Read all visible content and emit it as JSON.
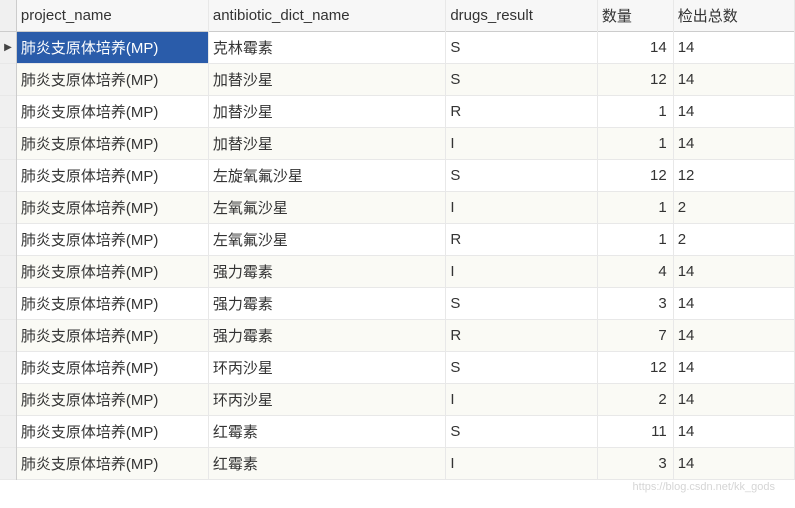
{
  "columns": {
    "col1": "project_name",
    "col2": "antibiotic_dict_name",
    "col3": "drugs_result",
    "col4": "数量",
    "col5": "检出总数"
  },
  "rows": [
    {
      "project_name": "肺炎支原体培养(MP)",
      "antibiotic": "克林霉素",
      "result": "S",
      "qty": "14",
      "total": "14"
    },
    {
      "project_name": "肺炎支原体培养(MP)",
      "antibiotic": "加替沙星",
      "result": "S",
      "qty": "12",
      "total": "14"
    },
    {
      "project_name": "肺炎支原体培养(MP)",
      "antibiotic": "加替沙星",
      "result": "R",
      "qty": "1",
      "total": "14"
    },
    {
      "project_name": "肺炎支原体培养(MP)",
      "antibiotic": "加替沙星",
      "result": "I",
      "qty": "1",
      "total": "14"
    },
    {
      "project_name": "肺炎支原体培养(MP)",
      "antibiotic": "左旋氧氟沙星",
      "result": "S",
      "qty": "12",
      "total": "12"
    },
    {
      "project_name": "肺炎支原体培养(MP)",
      "antibiotic": "左氧氟沙星",
      "result": "I",
      "qty": "1",
      "total": "2"
    },
    {
      "project_name": "肺炎支原体培养(MP)",
      "antibiotic": "左氧氟沙星",
      "result": "R",
      "qty": "1",
      "total": "2"
    },
    {
      "project_name": "肺炎支原体培养(MP)",
      "antibiotic": "强力霉素",
      "result": "I",
      "qty": "4",
      "total": "14"
    },
    {
      "project_name": "肺炎支原体培养(MP)",
      "antibiotic": "强力霉素",
      "result": "S",
      "qty": "3",
      "total": "14"
    },
    {
      "project_name": "肺炎支原体培养(MP)",
      "antibiotic": "强力霉素",
      "result": "R",
      "qty": "7",
      "total": "14"
    },
    {
      "project_name": "肺炎支原体培养(MP)",
      "antibiotic": "环丙沙星",
      "result": "S",
      "qty": "12",
      "total": "14"
    },
    {
      "project_name": "肺炎支原体培养(MP)",
      "antibiotic": "环丙沙星",
      "result": "I",
      "qty": "2",
      "total": "14"
    },
    {
      "project_name": "肺炎支原体培养(MP)",
      "antibiotic": "红霉素",
      "result": "S",
      "qty": "11",
      "total": "14"
    },
    {
      "project_name": "肺炎支原体培养(MP)",
      "antibiotic": "红霉素",
      "result": "I",
      "qty": "3",
      "total": "14"
    }
  ],
  "watermark": "https://blog.csdn.net/kk_gods"
}
